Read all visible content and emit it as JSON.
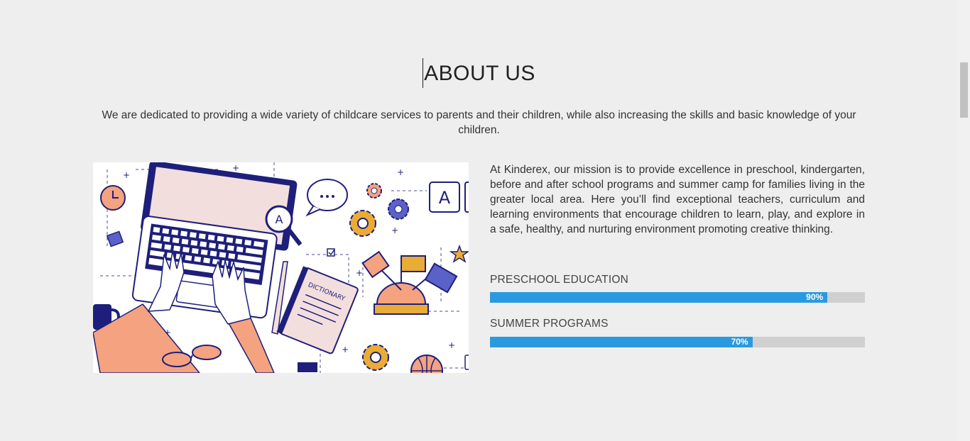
{
  "section": {
    "title": "ABOUT US",
    "intro": "We are dedicated to providing a wide variety of childcare services to parents and their children, while also increasing the skills and basic knowledge of your children.",
    "mission": "At Kinderex, our mission is to provide excellence in preschool, kindergarten, before and after school programs and summer camp for families living in the greater local area. Here you’ll find exceptional teachers, curriculum and learning environments that encourage children to learn, play, and explore in a safe, healthy, and nurturing environment promoting creative thinking."
  },
  "illustration": {
    "icon": "laptop-learning-illustration",
    "dictionary_text": "DICTIONARY",
    "letter": "A"
  },
  "skills": [
    {
      "label": "PRESCHOOL EDUCATION",
      "percent": 90,
      "percent_text": "90%"
    },
    {
      "label": "SUMMER PROGRAMS",
      "percent": 70,
      "percent_text": "70%"
    }
  ],
  "colors": {
    "accent": "#2a9ae0",
    "track": "#d0d0d0",
    "illustration_navy": "#1e1f7a",
    "illustration_orange": "#f4a27f",
    "illustration_yellow": "#e9ac35"
  }
}
